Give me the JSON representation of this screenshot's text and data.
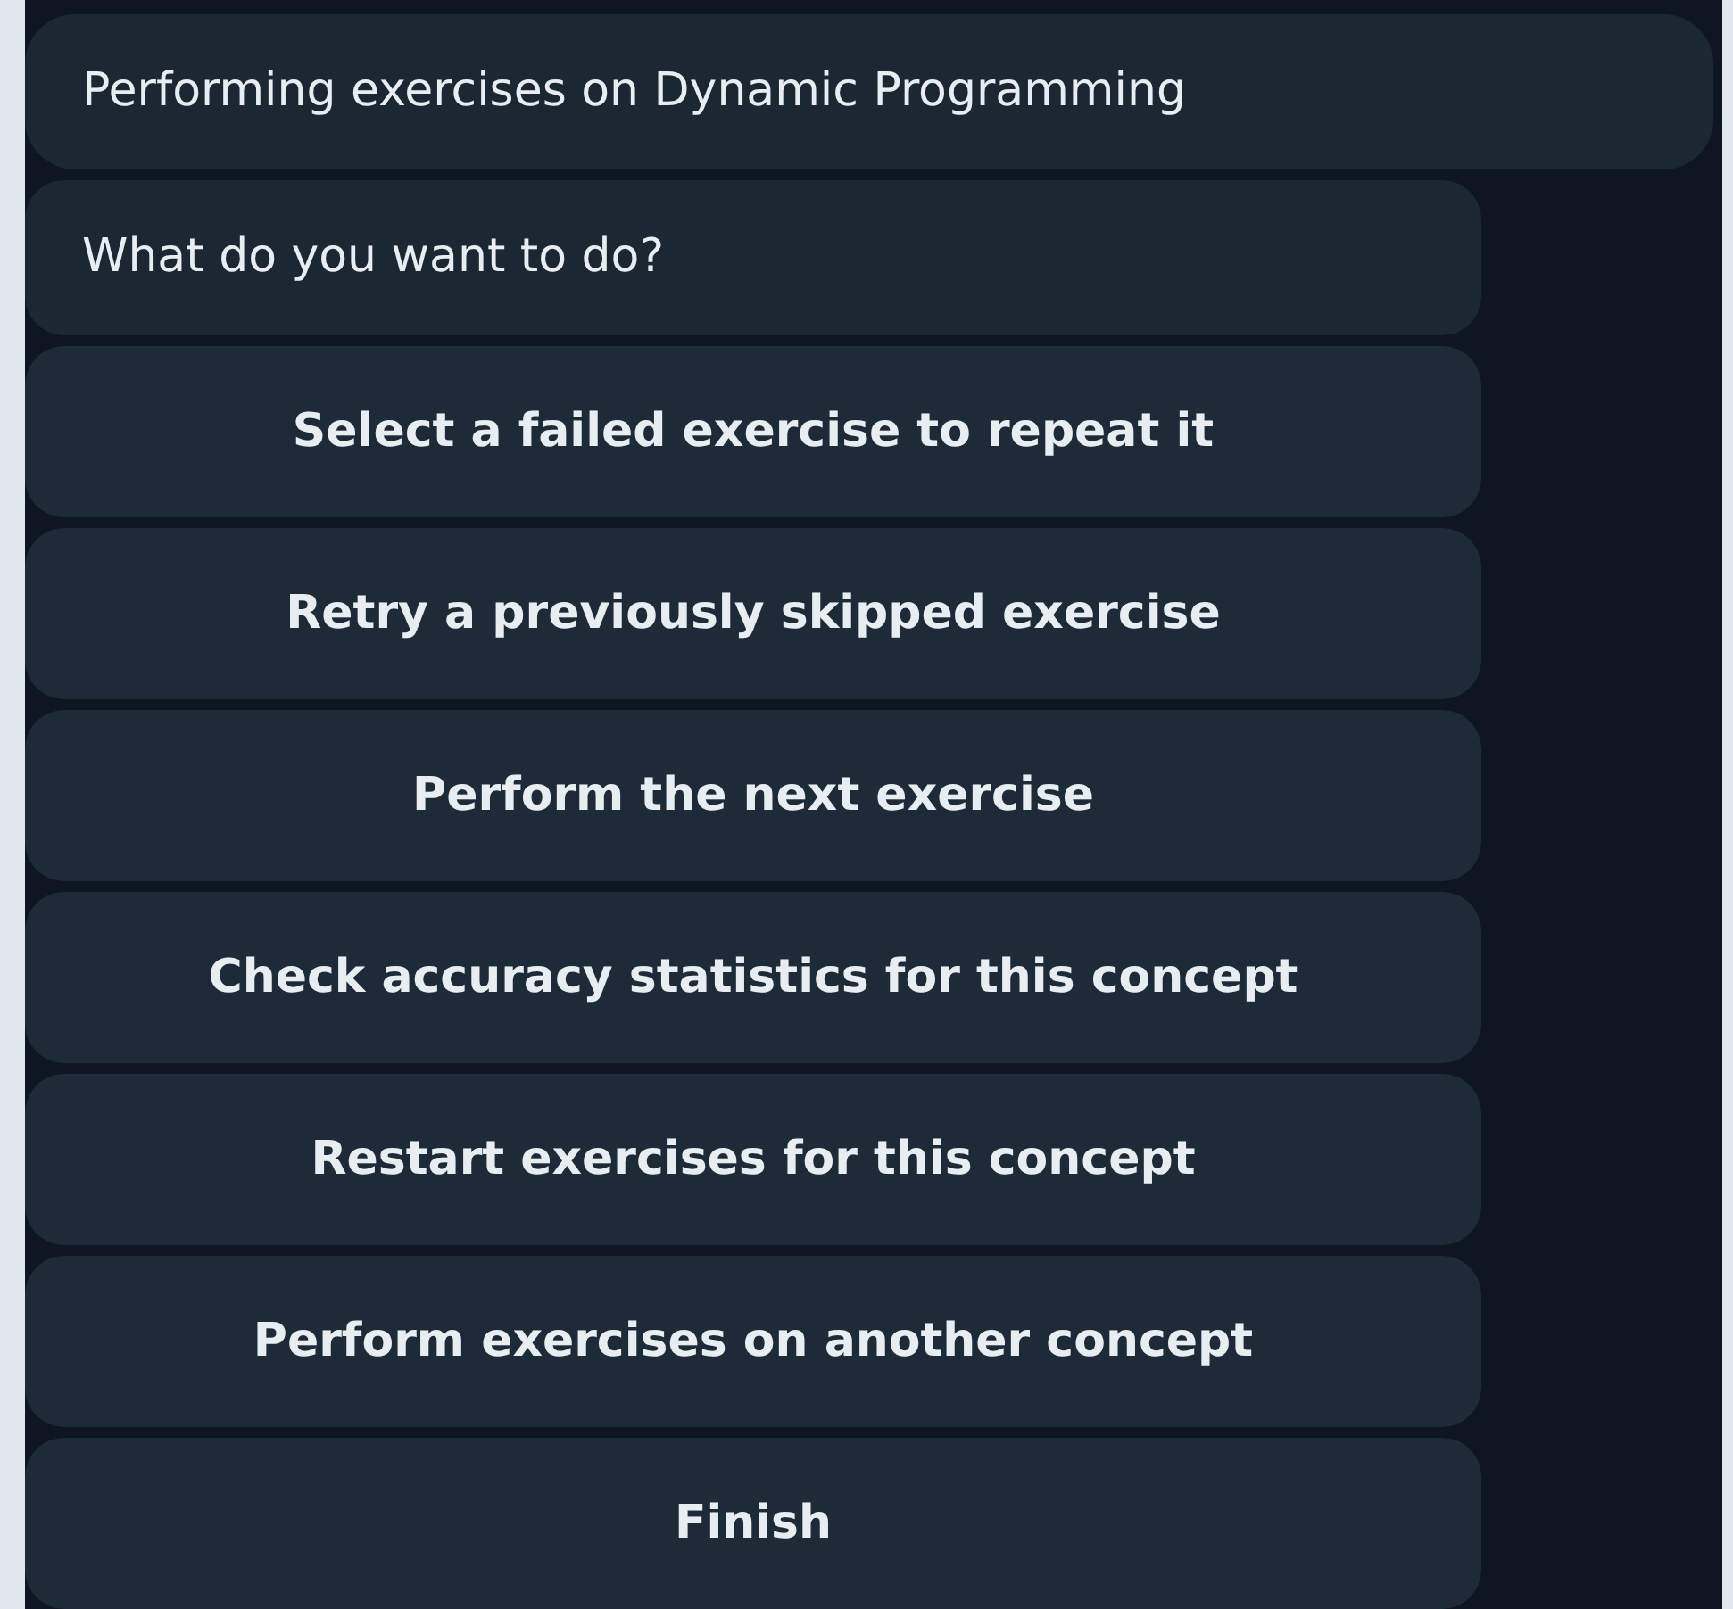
{
  "messages": [
    "Performing exercises on Dynamic Programming",
    "What do you want to do?"
  ],
  "buttons": [
    "Select a failed exercise to repeat it",
    "Retry a previously skipped exercise",
    "Perform the next exercise",
    "Check accuracy statistics for this concept",
    "Restart exercises for this concept",
    "Perform exercises on another concept",
    "Finish"
  ]
}
